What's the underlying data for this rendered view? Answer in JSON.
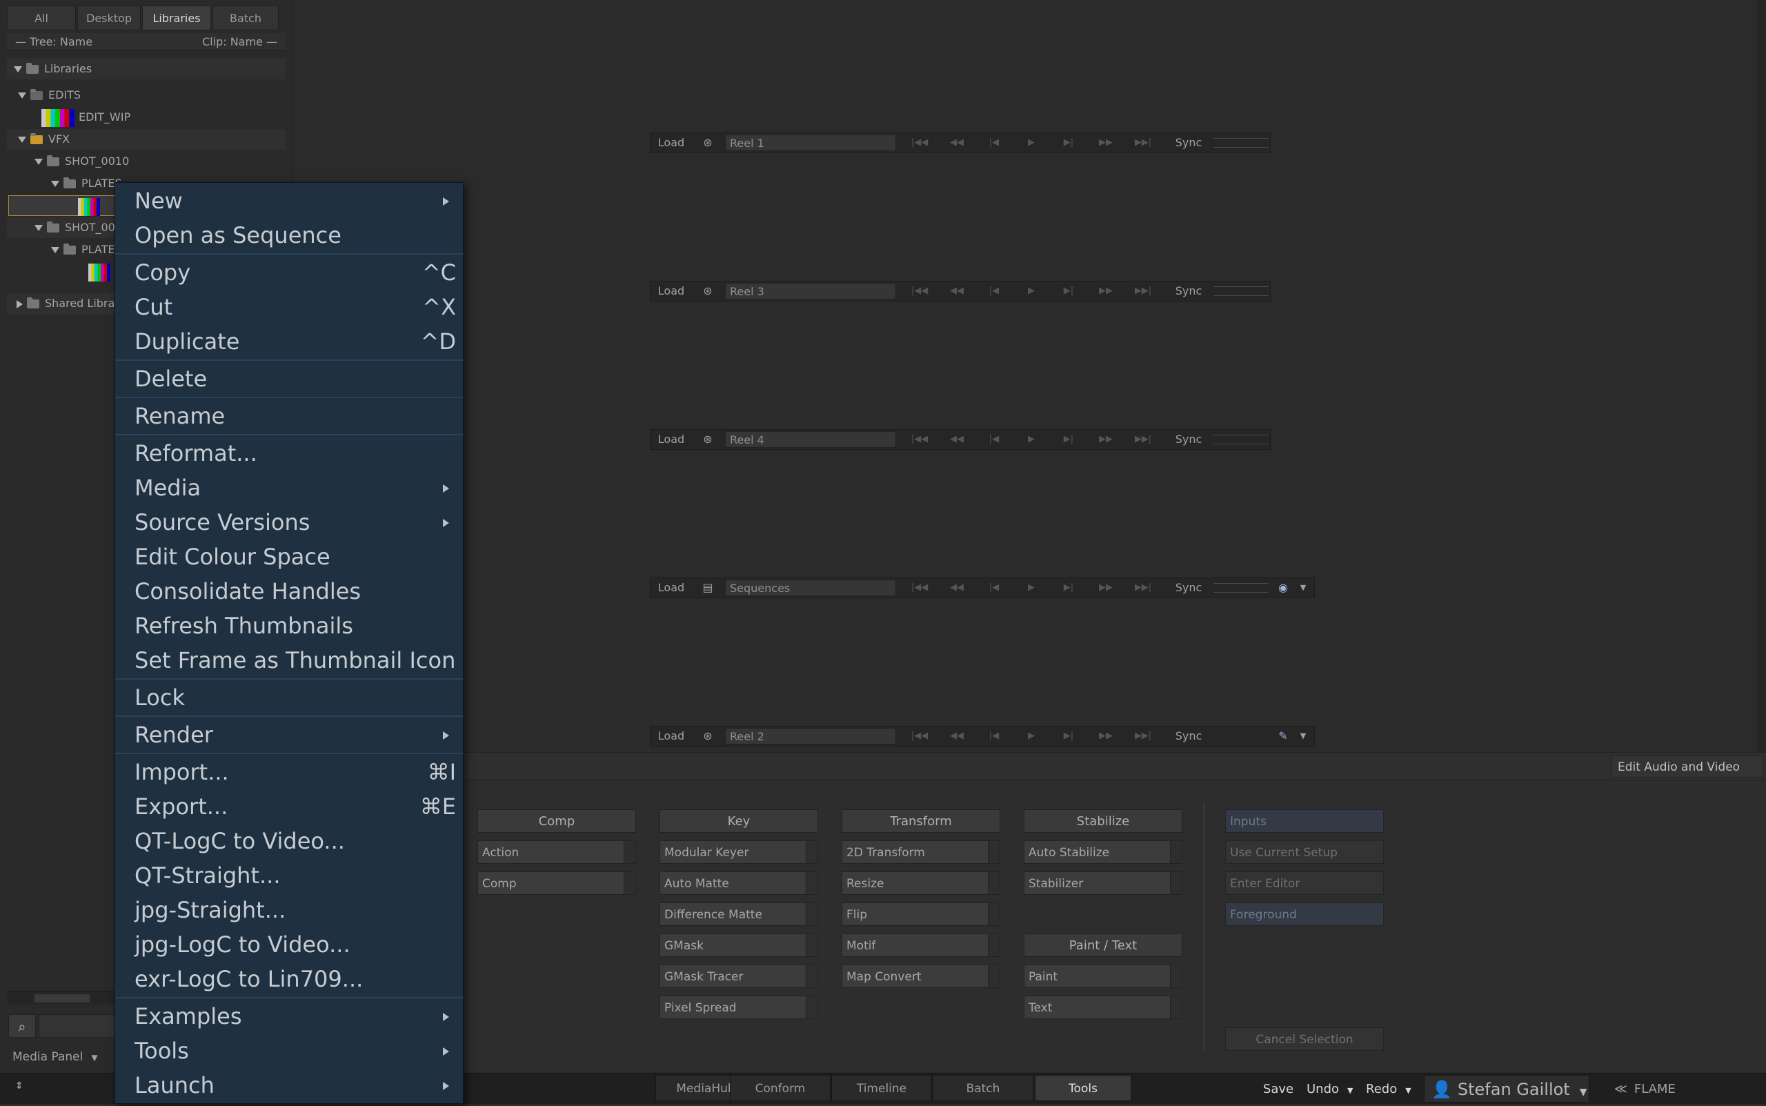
{
  "media_panel": {
    "tabs": [
      "All",
      "Desktop",
      "Libraries",
      "Batch"
    ],
    "active_tab": "Libraries",
    "tree_header": {
      "left": "— Tree: Name",
      "right": "Clip: Name —"
    },
    "tree": [
      {
        "label": "Libraries"
      },
      {
        "label": "EDITS"
      },
      {
        "label": "EDIT_WIP"
      },
      {
        "label": "VFX"
      },
      {
        "label": "SHOT_0010"
      },
      {
        "label": "PLATES"
      },
      {
        "label": ""
      },
      {
        "label": "SHOT_00"
      },
      {
        "label": "PLATE"
      },
      {
        "label": ""
      },
      {
        "label": "Shared Libra"
      }
    ],
    "bottom_select": "Media Panel"
  },
  "reels": [
    {
      "name": "Reel 1",
      "load": "Load",
      "sync": "Sync"
    },
    {
      "name": "Reel 3",
      "load": "Load",
      "sync": "Sync"
    },
    {
      "name": "Reel 4",
      "load": "Load",
      "sync": "Sync"
    },
    {
      "name": "Sequences",
      "load": "Load",
      "sync": "Sync"
    },
    {
      "name": "Reel 2",
      "load": "Load",
      "sync": "Sync"
    }
  ],
  "edit_audio_video": "Edit Audio and Video",
  "tools": {
    "columns": [
      {
        "title": "Comp",
        "items": [
          "Action",
          "Comp"
        ]
      },
      {
        "title": "Key",
        "items": [
          "Modular Keyer",
          "Auto Matte",
          "Difference Matte",
          "GMask",
          "GMask Tracer",
          "Pixel Spread"
        ]
      },
      {
        "title": "Transform",
        "items": [
          "2D Transform",
          "Resize",
          "Flip",
          "Motif",
          "Map Convert"
        ]
      },
      {
        "title": "Stabilize",
        "items": [
          "Auto Stabilize",
          "Stabilizer"
        ]
      },
      {
        "title": "Paint / Text",
        "items": [
          "Paint",
          "Text"
        ]
      }
    ],
    "side": [
      "Inputs",
      "Use Current Setup",
      "Enter Editor",
      "Foreground"
    ],
    "cancel": "Cancel Selection"
  },
  "bottom_tabs": [
    "MediaHub",
    "Conform",
    "Timeline",
    "Batch",
    "Tools"
  ],
  "active_bottom_tab": "Tools",
  "bottom_right": {
    "save": "Save",
    "undo": "Undo",
    "redo": "Redo",
    "user": "Stefan Gaillot",
    "app": "FLAME"
  },
  "context_menu": {
    "items": [
      {
        "label": "New",
        "shortcut": "",
        "submenu": true
      },
      {
        "label": "Open as Sequence",
        "shortcut": "",
        "submenu": false
      },
      {
        "label": "Copy",
        "shortcut": "^C",
        "submenu": false
      },
      {
        "label": "Cut",
        "shortcut": "^X",
        "submenu": false
      },
      {
        "label": "Duplicate",
        "shortcut": "^D",
        "submenu": false
      },
      {
        "label": "Delete",
        "shortcut": "",
        "submenu": false
      },
      {
        "label": "Rename",
        "shortcut": "",
        "submenu": false
      },
      {
        "label": "Reformat...",
        "shortcut": "",
        "submenu": false
      },
      {
        "label": "Media",
        "shortcut": "",
        "submenu": true
      },
      {
        "label": "Source Versions",
        "shortcut": "",
        "submenu": true
      },
      {
        "label": "Edit Colour Space",
        "shortcut": "",
        "submenu": false
      },
      {
        "label": "Consolidate Handles",
        "shortcut": "",
        "submenu": false
      },
      {
        "label": "Refresh Thumbnails",
        "shortcut": "",
        "submenu": false
      },
      {
        "label": "Set Frame as Thumbnail Icon",
        "shortcut": "",
        "submenu": false
      },
      {
        "label": "Lock",
        "shortcut": "",
        "submenu": false
      },
      {
        "label": "Render",
        "shortcut": "",
        "submenu": true
      },
      {
        "label": "Import...",
        "shortcut": "⌘I",
        "submenu": false
      },
      {
        "label": "Export...",
        "shortcut": "⌘E",
        "submenu": false
      },
      {
        "label": "QT-LogC to Video...",
        "shortcut": "",
        "submenu": false
      },
      {
        "label": "QT-Straight...",
        "shortcut": "",
        "submenu": false
      },
      {
        "label": "jpg-Straight...",
        "shortcut": "",
        "submenu": false
      },
      {
        "label": "jpg-LogC to Video...",
        "shortcut": "",
        "submenu": false
      },
      {
        "label": "exr-LogC to Lin709...",
        "shortcut": "",
        "submenu": false
      },
      {
        "label": "Examples",
        "shortcut": "",
        "submenu": true
      },
      {
        "label": "Tools",
        "shortcut": "",
        "submenu": true
      },
      {
        "label": "Launch",
        "shortcut": "",
        "submenu": true
      }
    ]
  }
}
